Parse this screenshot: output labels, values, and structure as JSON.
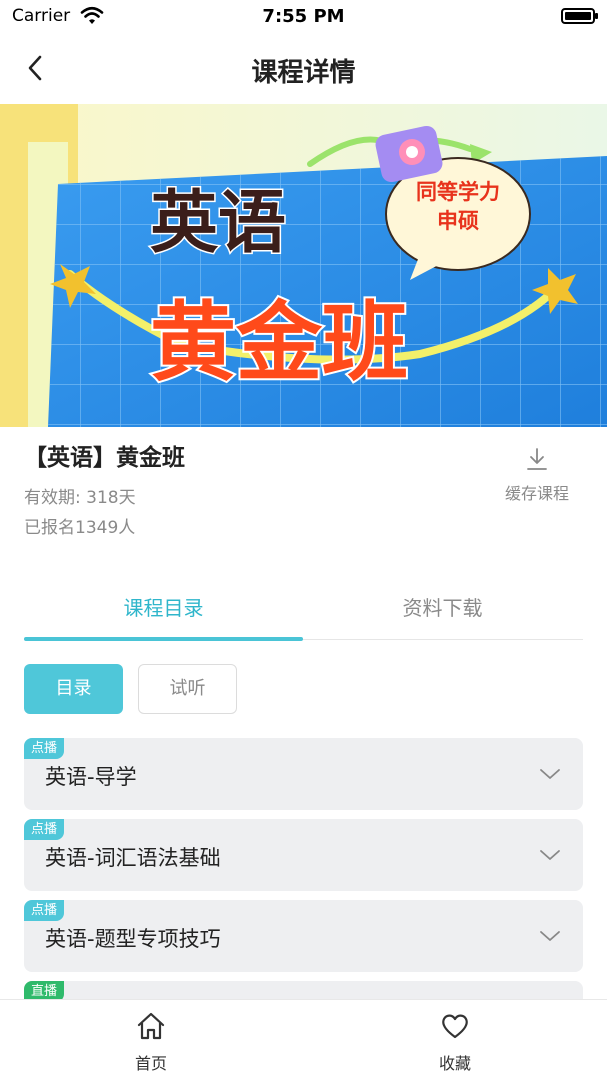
{
  "status_bar": {
    "carrier": "Carrier",
    "time": "7:55 PM"
  },
  "nav": {
    "title": "课程详情",
    "back_icon": "chevron-left-icon"
  },
  "banner": {
    "line1": "英语",
    "line2": "黄金班",
    "bubble_line1": "同等学力",
    "bubble_line2": "申硕"
  },
  "course": {
    "title": "【英语】黄金班",
    "validity": "有效期: 318天",
    "enrolled": "已报名1349人",
    "cache_label": "缓存课程",
    "cache_icon": "download-icon"
  },
  "tabs": [
    {
      "label": "课程目录",
      "active": true
    },
    {
      "label": "资料下载",
      "active": false
    }
  ],
  "segments": {
    "catalog": "目录",
    "trial": "试听"
  },
  "lessons": [
    {
      "tag": "点播",
      "title": "英语-导学"
    },
    {
      "tag": "点播",
      "title": "英语-词汇语法基础"
    },
    {
      "tag": "点播",
      "title": "英语-题型专项技巧"
    },
    {
      "tag": "直播",
      "title": ""
    }
  ],
  "tab_bar": {
    "home_label": "首页",
    "home_icon": "home-icon",
    "favorites_label": "收藏",
    "favorites_icon": "heart-icon"
  },
  "colors": {
    "accent": "#4fc7d9",
    "live": "#2fba6b",
    "banner_blue": "#2e8ee6",
    "banner_title_top": "#3b1e1a",
    "banner_title_bottom": "#ff4a1a"
  }
}
